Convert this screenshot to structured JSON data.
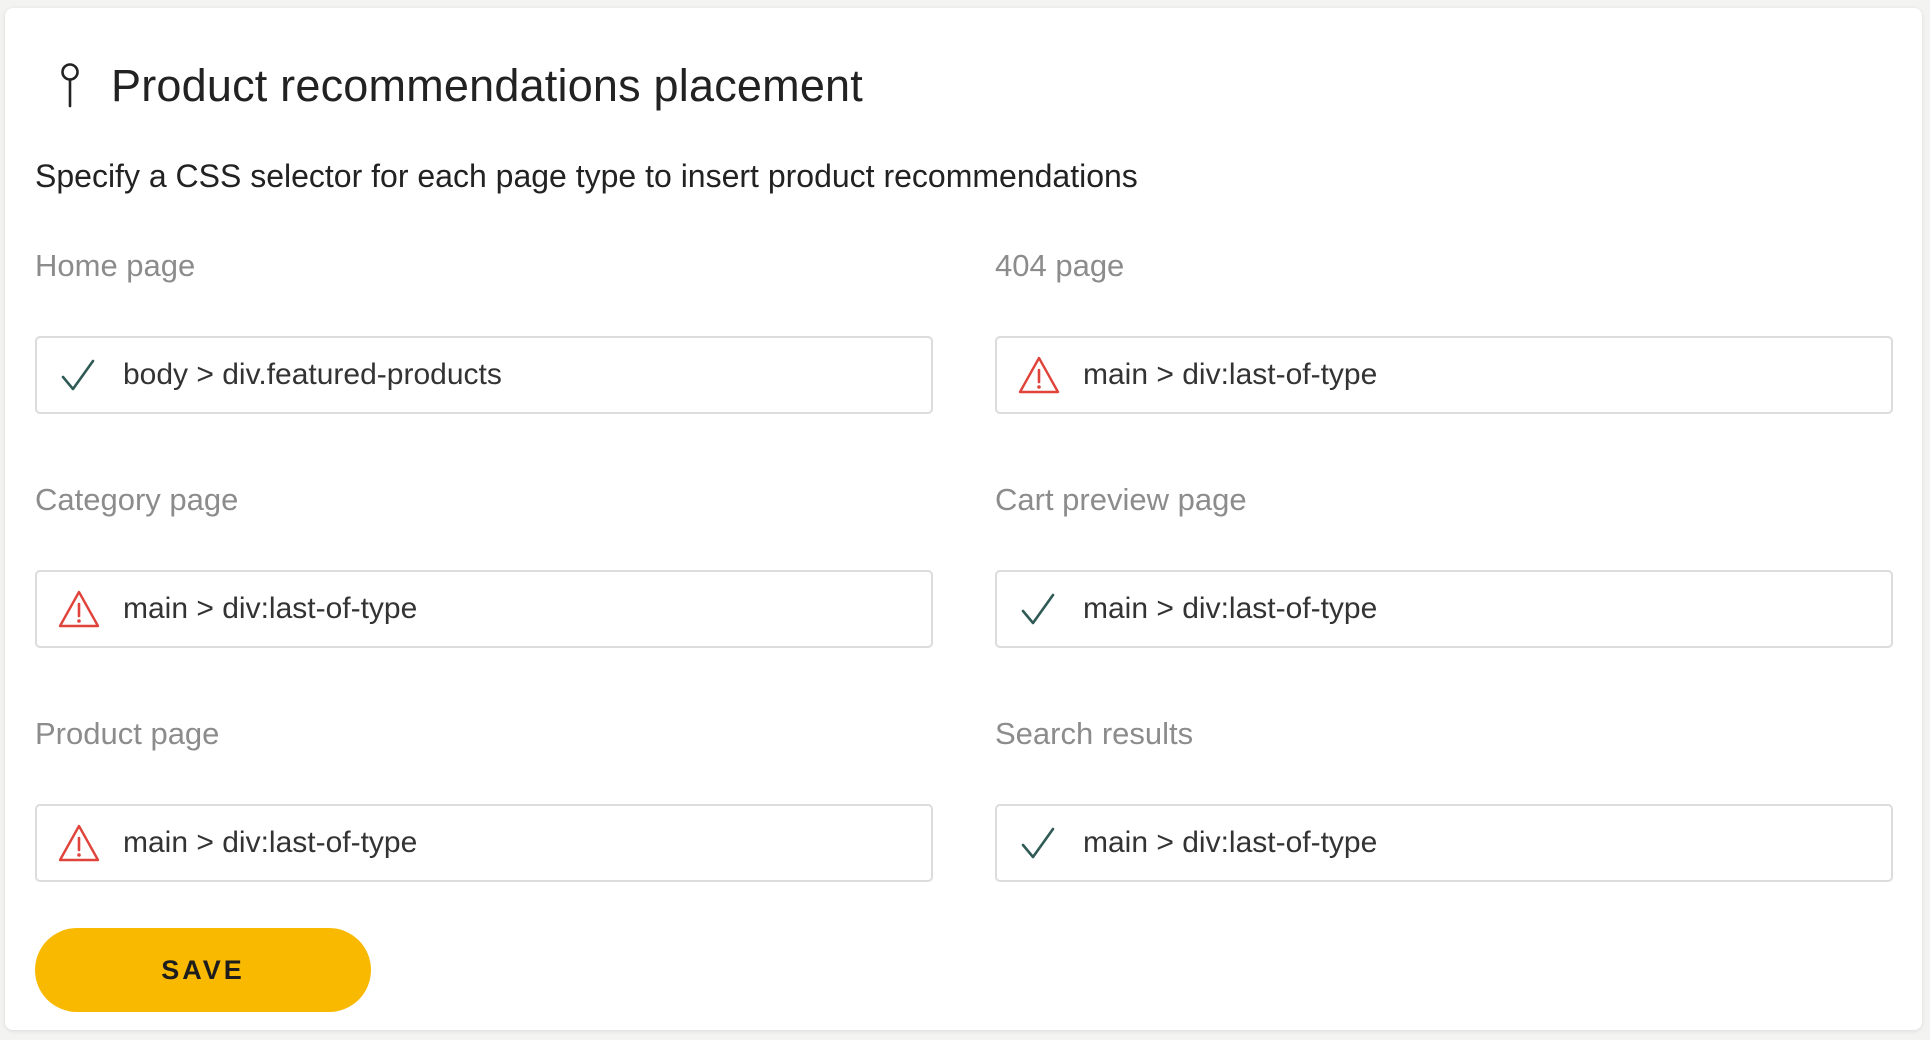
{
  "header": {
    "icon": "pin-icon",
    "title": "Product recommendations placement"
  },
  "subtitle": "Specify a CSS selector for each page type to insert product recommendations",
  "fields": [
    {
      "label": "Home page",
      "value": "body > div.featured-products",
      "status": "valid",
      "icon": "check-icon"
    },
    {
      "label": "404 page",
      "value": "main > div:last-of-type",
      "status": "warning",
      "icon": "warning-icon"
    },
    {
      "label": "Category page",
      "value": "main > div:last-of-type",
      "status": "warning",
      "icon": "warning-icon"
    },
    {
      "label": "Cart preview page",
      "value": "main > div:last-of-type",
      "status": "valid",
      "icon": "check-icon"
    },
    {
      "label": "Product page",
      "value": "main > div:last-of-type",
      "status": "warning",
      "icon": "warning-icon"
    },
    {
      "label": "Search results",
      "value": "main > div:last-of-type",
      "status": "valid",
      "icon": "check-icon"
    }
  ],
  "save_label": "SAVE",
  "colors": {
    "accent": "#f9b900",
    "check": "#2f5a55",
    "warning": "#e0433a"
  }
}
